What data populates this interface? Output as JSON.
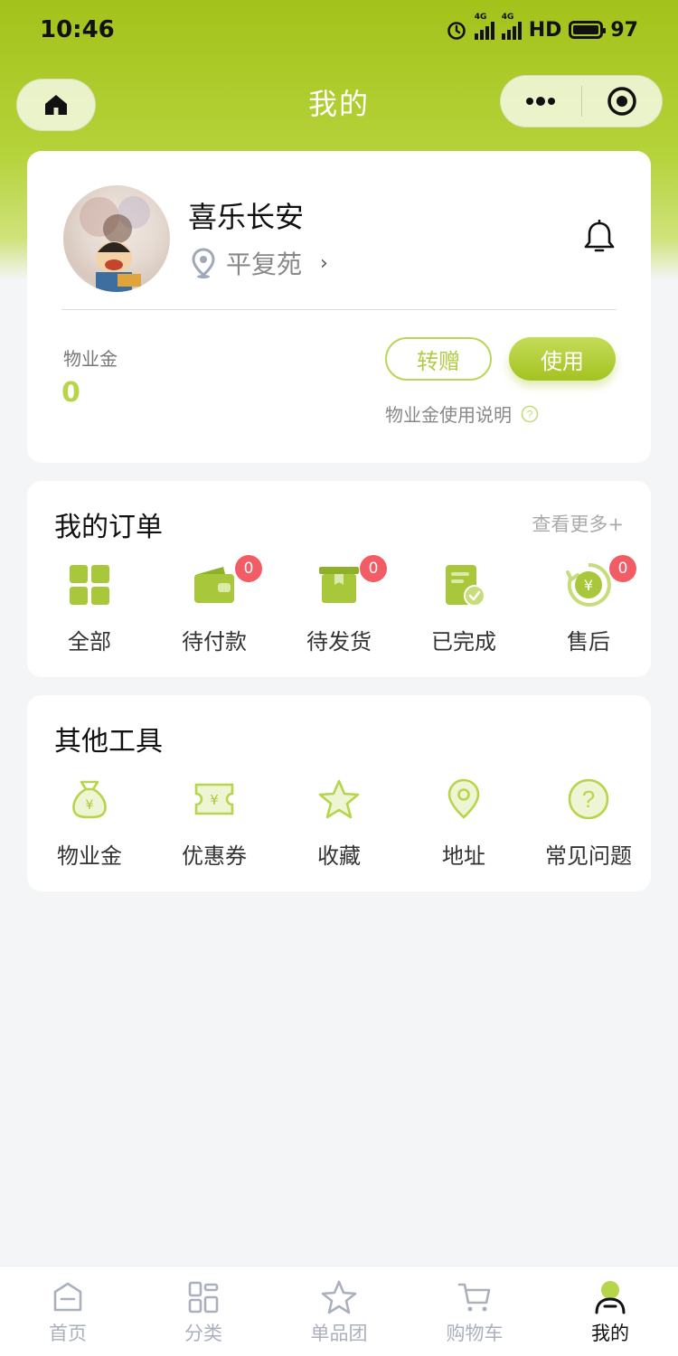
{
  "status_bar": {
    "time": "10:46",
    "network": "4G",
    "hd": "HD",
    "battery": "97"
  },
  "nav": {
    "title": "我的"
  },
  "profile": {
    "name": "喜乐长安",
    "community": "平复苑",
    "wallet_label": "物业金",
    "wallet_value": "0",
    "transfer_label": "转赠",
    "use_label": "使用",
    "help_label": "物业金使用说明"
  },
  "orders": {
    "title": "我的订单",
    "more_label": "查看更多+",
    "items": [
      {
        "label": "全部",
        "icon": "grid-icon"
      },
      {
        "label": "待付款",
        "icon": "wallet-icon",
        "badge": "0"
      },
      {
        "label": "待发货",
        "icon": "box-icon",
        "badge": "0"
      },
      {
        "label": "已完成",
        "icon": "document-check-icon"
      },
      {
        "label": "售后",
        "icon": "refund-icon",
        "badge": "0"
      }
    ]
  },
  "tools": {
    "title": "其他工具",
    "items": [
      {
        "label": "物业金",
        "icon": "money-bag-icon"
      },
      {
        "label": "优惠券",
        "icon": "coupon-icon"
      },
      {
        "label": "收藏",
        "icon": "star-icon"
      },
      {
        "label": "地址",
        "icon": "location-pin-icon"
      },
      {
        "label": "常见问题",
        "icon": "question-icon"
      }
    ]
  },
  "tabbar": {
    "items": [
      {
        "label": "首页",
        "icon": "home-tab-icon"
      },
      {
        "label": "分类",
        "icon": "category-tab-icon"
      },
      {
        "label": "单品团",
        "icon": "star-tab-icon"
      },
      {
        "label": "购物车",
        "icon": "cart-tab-icon"
      },
      {
        "label": "我的",
        "icon": "profile-tab-icon",
        "active": true
      }
    ]
  },
  "colors": {
    "accent": "#a4c221",
    "accent_light": "#b7d54b",
    "badge": "#f25c64"
  }
}
